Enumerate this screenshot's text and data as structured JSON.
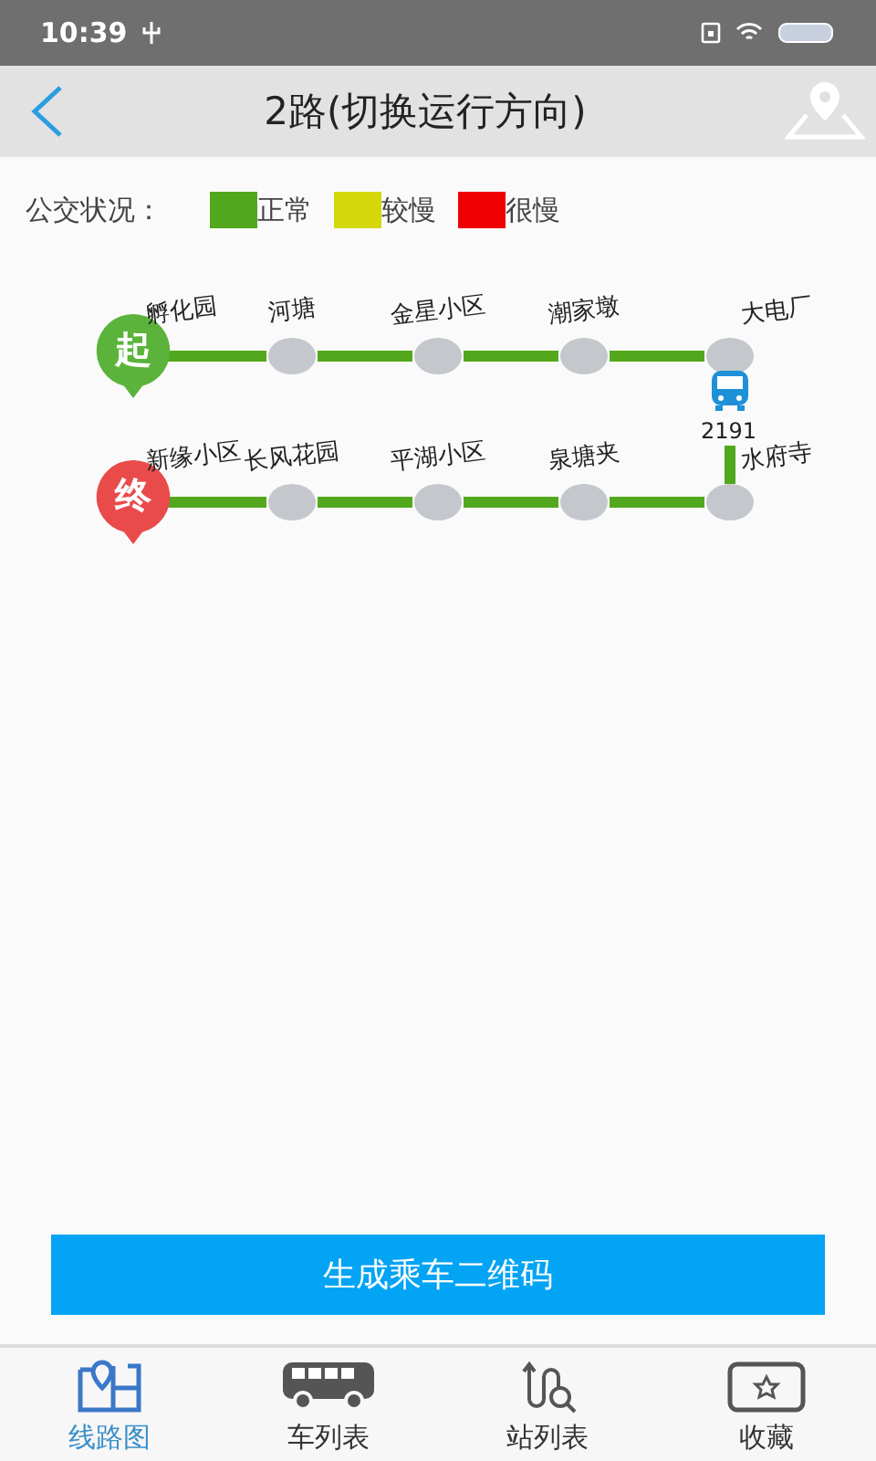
{
  "status_bar": {
    "time": "10:39"
  },
  "header": {
    "title": "2路(切换运行方向)"
  },
  "legend": {
    "label": "公交状况：",
    "items": [
      {
        "label": "正常",
        "color": "#52a81c"
      },
      {
        "label": "较慢",
        "color": "#d4d80a"
      },
      {
        "label": "很慢",
        "color": "#f00000"
      }
    ]
  },
  "route": {
    "start_marker": "起",
    "end_marker": "终",
    "top_row": [
      "孵化园",
      "河塘",
      "金星小区",
      "潮家墩",
      "大电厂"
    ],
    "bottom_row": [
      "新缘小区",
      "长风花园",
      "平湖小区",
      "泉塘夹",
      "水府寺"
    ],
    "bus": {
      "number": "2191"
    }
  },
  "button": "生成乘车二维码",
  "tabs": [
    {
      "label": "线路图",
      "selected": true
    },
    {
      "label": "车列表",
      "selected": false
    },
    {
      "label": "站列表",
      "selected": false
    },
    {
      "label": "收藏",
      "selected": false
    }
  ]
}
